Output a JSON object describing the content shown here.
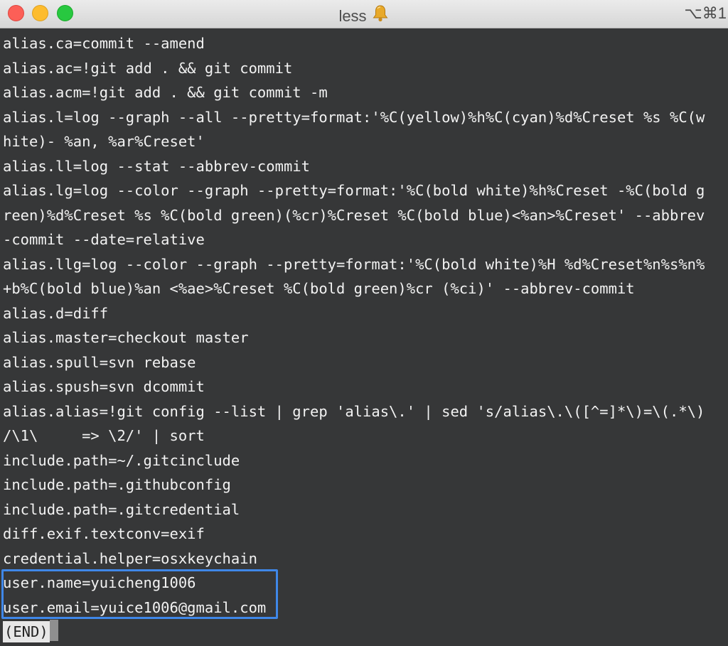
{
  "window": {
    "title": "less",
    "shortcut": "⌥⌘1"
  },
  "terminal": {
    "lines": [
      "alias.ca=commit --amend",
      "alias.ac=!git add . && git commit",
      "alias.acm=!git add . && git commit -m",
      "alias.l=log --graph --all --pretty=format:'%C(yellow)%h%C(cyan)%d%Creset %s %C(w",
      "hite)- %an, %ar%Creset'",
      "alias.ll=log --stat --abbrev-commit",
      "alias.lg=log --color --graph --pretty=format:'%C(bold white)%h%Creset -%C(bold g",
      "reen)%d%Creset %s %C(bold green)(%cr)%Creset %C(bold blue)<%an>%Creset' --abbrev",
      "-commit --date=relative",
      "alias.llg=log --color --graph --pretty=format:'%C(bold white)%H %d%Creset%n%s%n%",
      "+b%C(bold blue)%an <%ae>%Creset %C(bold green)%cr (%ci)' --abbrev-commit",
      "alias.d=diff",
      "alias.master=checkout master",
      "alias.spull=svn rebase",
      "alias.spush=svn dcommit",
      "alias.alias=!git config --list | grep 'alias\\.' | sed 's/alias\\.\\([^=]*\\)=\\(.*\\)",
      "/\\1\\     => \\2/' | sort",
      "include.path=~/.gitcinclude",
      "include.path=.githubconfig",
      "include.path=.gitcredential",
      "diff.exif.textconv=exif",
      "credential.helper=osxkeychain",
      "user.name=yuicheng1006",
      "user.email=yuice1006@gmail.com"
    ],
    "end_marker": "(END)"
  },
  "colors": {
    "background": "#363738",
    "text": "#f2f2f2",
    "highlight_border": "#3f87e8"
  }
}
